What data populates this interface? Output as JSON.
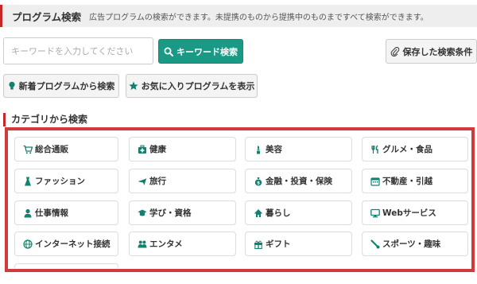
{
  "header": {
    "title": "プログラム検索",
    "description": "広告プログラムの検索ができます。未提携のものから提携中のものまですべて検索ができます。"
  },
  "search": {
    "placeholder": "キーワードを入力してください",
    "button_label": "キーワード検索"
  },
  "buttons": {
    "saved_conditions": "保存した検索条件",
    "new_programs": "新着プログラムから検索",
    "favorites": "お気に入りプログラムを表示"
  },
  "category_section": {
    "title": "カテゴリから検索",
    "items": [
      {
        "label": "総合通販",
        "icon": "cart-icon"
      },
      {
        "label": "健康",
        "icon": "first-aid-icon"
      },
      {
        "label": "美容",
        "icon": "lipstick-icon"
      },
      {
        "label": "グルメ・食品",
        "icon": "fork-knife-icon"
      },
      {
        "label": "ファッション",
        "icon": "dress-icon"
      },
      {
        "label": "旅行",
        "icon": "airplane-icon"
      },
      {
        "label": "金融・投資・保険",
        "icon": "money-bag-icon"
      },
      {
        "label": "不動産・引越",
        "icon": "building-icon"
      },
      {
        "label": "仕事情報",
        "icon": "person-icon"
      },
      {
        "label": "学び・資格",
        "icon": "graduation-cap-icon"
      },
      {
        "label": "暮らし",
        "icon": "house-icon"
      },
      {
        "label": "Webサービス",
        "icon": "monitor-icon"
      },
      {
        "label": "インターネット接続",
        "icon": "globe-icon"
      },
      {
        "label": "エンタメ",
        "icon": "people-icon"
      },
      {
        "label": "ギフト",
        "icon": "gift-icon"
      },
      {
        "label": "スポーツ・趣味",
        "icon": "sports-icon"
      }
    ]
  },
  "colors": {
    "accent_teal": "#1a9a85",
    "accent_red": "#d23b3b",
    "icon_teal": "#14806f"
  }
}
